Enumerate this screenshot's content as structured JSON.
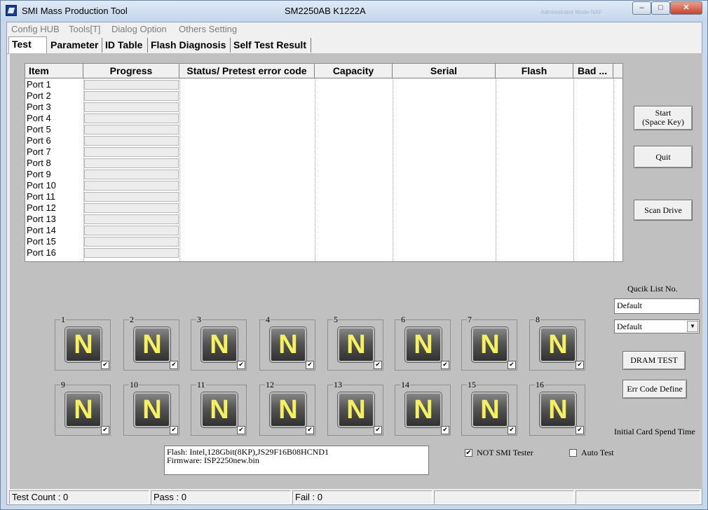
{
  "window": {
    "title": "SMI Mass Production Tool",
    "chip": "SM2250AB  K1222A",
    "bg_title": "Administrator Mode-NAF",
    "minimize": "–",
    "maximize": "□",
    "close": "✕"
  },
  "menu": [
    "Config HUB",
    "Tools[T]",
    "Dialog Option",
    "Others Setting"
  ],
  "tabs": [
    "Test",
    "Parameter",
    "ID Table",
    "Flash Diagnosis",
    "Self Test Result"
  ],
  "grid": {
    "columns": [
      "Item",
      "Progress",
      "Status/ Pretest error code",
      "Capacity",
      "Serial",
      "Flash",
      "Bad ..."
    ],
    "ports": [
      "Port 1",
      "Port 2",
      "Port 3",
      "Port 4",
      "Port 5",
      "Port 6",
      "Port 7",
      "Port 8",
      "Port 9",
      "Port 10",
      "Port 11",
      "Port 12",
      "Port 13",
      "Port 14",
      "Port 15",
      "Port 16"
    ]
  },
  "buttons": {
    "start_line1": "Start",
    "start_line2": "(Space Key)",
    "quit": "Quit",
    "scan": "Scan Drive",
    "dram": "DRAM TEST",
    "err": "Err Code Define"
  },
  "port_icons": {
    "labels": [
      "1",
      "2",
      "3",
      "4",
      "5",
      "6",
      "7",
      "8",
      "9",
      "10",
      "11",
      "12",
      "13",
      "14",
      "15",
      "16"
    ],
    "glyph": "N",
    "checked_mark": "✔"
  },
  "quick_list": {
    "label": "Qucik List No.",
    "text_value": "Default",
    "select_value": "Default",
    "arrow": "▼"
  },
  "initial_card_spend_time": "Initial Card Spend Time",
  "info": {
    "flash": "Flash:   Intel,128Gbit(8KP),JS29F16B08HCND1",
    "firmware": "Firmware:   ISP2250new.bin"
  },
  "checks": {
    "not_smi_label": "NOT SMI Tester",
    "not_smi_mark": "✔",
    "auto_test_label": "Auto Test"
  },
  "status": {
    "test_count": "Test Count : 0",
    "pass": "Pass : 0",
    "fail": "Fail : 0"
  },
  "colors": {
    "panel": "#c0c0c0",
    "n_glyph": "#f4f060"
  }
}
